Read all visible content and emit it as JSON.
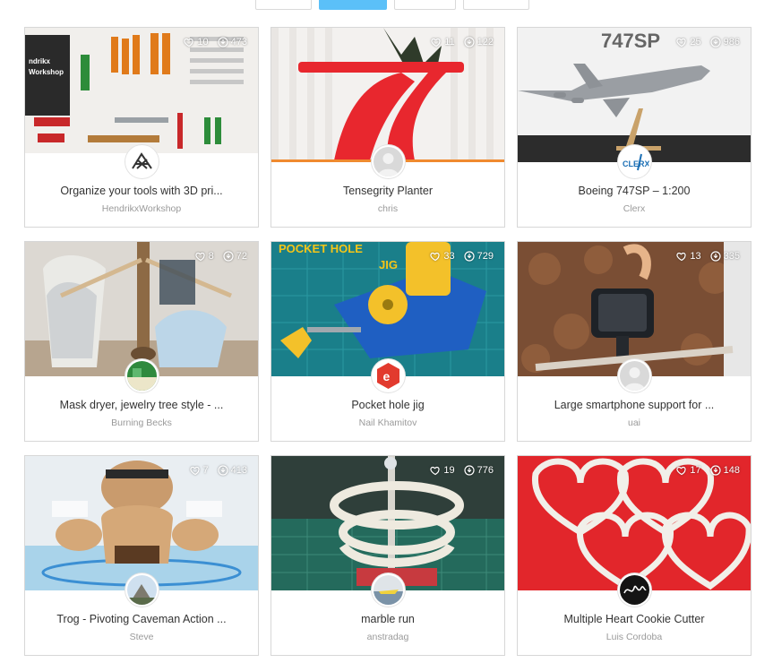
{
  "tabs": [
    {
      "label": ""
    },
    {
      "label": "",
      "active": true
    },
    {
      "label": ""
    },
    {
      "label": ""
    }
  ],
  "accent_color": "#5bc0f8",
  "cards": [
    {
      "title": "Organize your tools with 3D pri...",
      "author": "HendrikxWorkshop",
      "likes": "10",
      "downloads": "473",
      "image_text": "ndrikx Workshop",
      "avatar": "truss-logo"
    },
    {
      "title": "Tensegrity Planter",
      "author": "chris",
      "likes": "11",
      "downloads": "122",
      "image_text": "",
      "avatar": "default-user"
    },
    {
      "title": "Boeing 747SP – 1:200",
      "author": "Clerx",
      "likes": "25",
      "downloads": "986",
      "image_text": "747SP",
      "avatar": "clerx-logo"
    },
    {
      "title": "Mask dryer, jewelry tree style - ...",
      "author": "Burning Becks",
      "likes": "8",
      "downloads": "72",
      "image_text": "",
      "avatar": "green-photo"
    },
    {
      "title": "Pocket hole jig",
      "author": "Nail Khamitov",
      "likes": "33",
      "downloads": "729",
      "image_text": "POCKET HOLE JIG",
      "avatar": "red-e-logo"
    },
    {
      "title": "Large smartphone support for ...",
      "author": "uai",
      "likes": "13",
      "downloads": "335",
      "image_text": "",
      "avatar": "default-user"
    },
    {
      "title": "Trog - Pivoting Caveman Action ...",
      "author": "Steve",
      "likes": "7",
      "downloads": "413",
      "image_text": "",
      "avatar": "landscape-photo"
    },
    {
      "title": "marble run",
      "author": "anstradag",
      "likes": "19",
      "downloads": "776",
      "image_text": "",
      "avatar": "boat-photo"
    },
    {
      "title": "Multiple Heart Cookie Cutter",
      "author": "Luis Cordoba",
      "likes": "17",
      "downloads": "148",
      "image_text": "",
      "avatar": "signature-logo"
    }
  ]
}
